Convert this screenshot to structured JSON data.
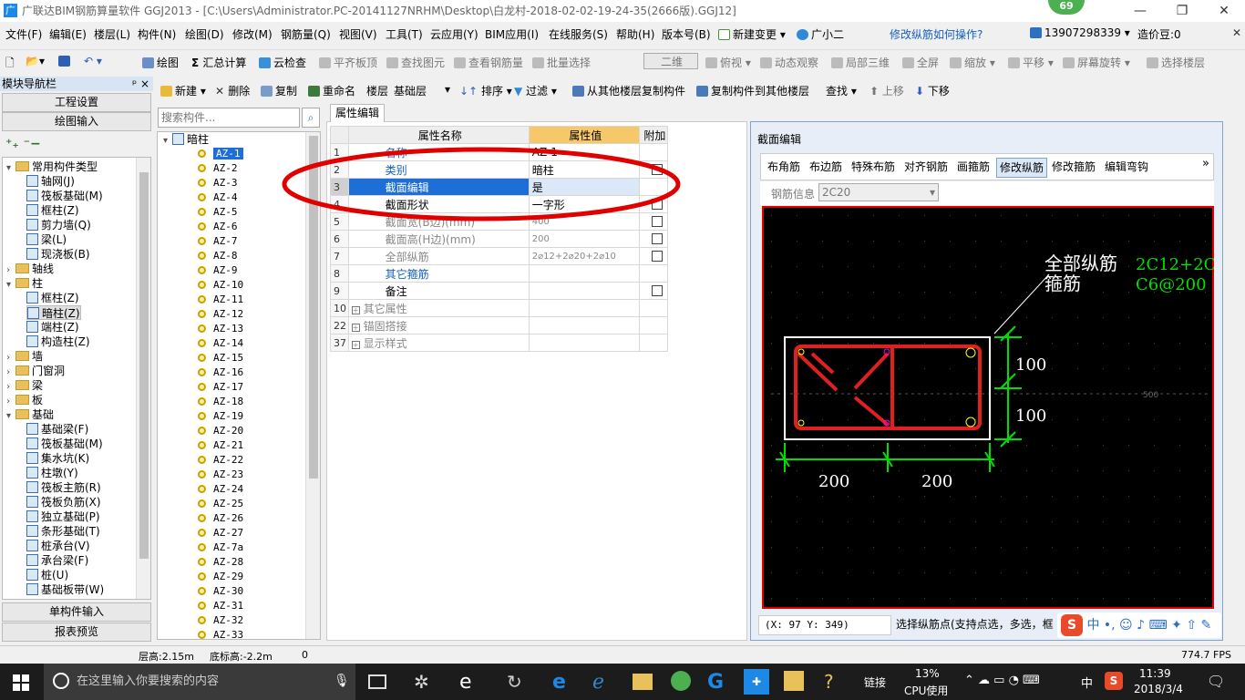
{
  "window": {
    "title": "广联达BIM钢筋算量软件 GGJ2013 - [C:\\Users\\Administrator.PC-20141127NRHM\\Desktop\\白龙村-2018-02-02-19-24-35(2666版).GGJ12]",
    "badge": "69",
    "minimize": "—",
    "restore": "❐",
    "close": "✕",
    "app_icon": "广"
  },
  "menu": [
    "文件(F)",
    "编辑(E)",
    "楼层(L)",
    "构件(N)",
    "绘图(D)",
    "修改(M)",
    "钢筋量(Q)",
    "视图(V)",
    "工具(T)",
    "云应用(Y)",
    "BIM应用(I)",
    "在线服务(S)",
    "帮助(H)",
    "版本号(B)",
    "新建变更 ▾",
    "广小二",
    "修改纵筋如何操作?",
    "13907298339 ▾",
    "造价豆:0"
  ],
  "toolbar1": [
    "绘图",
    "汇总计算",
    "云检查",
    "平齐板顶",
    "查找图元",
    "查看钢筋量",
    "批量选择",
    "二维",
    "俯视 ▾",
    "动态观察",
    "局部三维",
    "全屏",
    "缩放 ▾",
    "平移 ▾",
    "屏幕旋转 ▾",
    "选择楼层"
  ],
  "toolbar2": [
    "新建 ▾",
    "删除",
    "复制",
    "重命名",
    "楼层",
    "基础层",
    "排序 ▾",
    "过滤 ▾",
    "从其他楼层复制构件",
    "复制构件到其他楼层",
    "查找 ▾",
    "上移",
    "下移"
  ],
  "nav": {
    "header": "模块导航栏",
    "pin": "ᵖ ×",
    "btn_project": "工程设置",
    "btn_draw": "绘图输入",
    "btn_single": "单构件输入",
    "btn_report": "报表预览",
    "tree": [
      {
        "t": "常用构件类型",
        "lvl": 0,
        "folder": true,
        "exp": "▾"
      },
      {
        "t": "轴网(J)",
        "lvl": 1
      },
      {
        "t": "筏板基础(M)",
        "lvl": 1
      },
      {
        "t": "框柱(Z)",
        "lvl": 1
      },
      {
        "t": "剪力墙(Q)",
        "lvl": 1
      },
      {
        "t": "梁(L)",
        "lvl": 1
      },
      {
        "t": "现浇板(B)",
        "lvl": 1
      },
      {
        "t": "轴线",
        "lvl": 0,
        "folder": true,
        "exp": "›"
      },
      {
        "t": "柱",
        "lvl": 0,
        "folder": true,
        "exp": "▾"
      },
      {
        "t": "框柱(Z)",
        "lvl": 1
      },
      {
        "t": "暗柱(Z)",
        "lvl": 1,
        "sel": true
      },
      {
        "t": "端柱(Z)",
        "lvl": 1
      },
      {
        "t": "构造柱(Z)",
        "lvl": 1
      },
      {
        "t": "墙",
        "lvl": 0,
        "folder": true,
        "exp": "›"
      },
      {
        "t": "门窗洞",
        "lvl": 0,
        "folder": true,
        "exp": "›"
      },
      {
        "t": "梁",
        "lvl": 0,
        "folder": true,
        "exp": "›"
      },
      {
        "t": "板",
        "lvl": 0,
        "folder": true,
        "exp": "›"
      },
      {
        "t": "基础",
        "lvl": 0,
        "folder": true,
        "exp": "▾"
      },
      {
        "t": "基础梁(F)",
        "lvl": 1
      },
      {
        "t": "筏板基础(M)",
        "lvl": 1
      },
      {
        "t": "集水坑(K)",
        "lvl": 1
      },
      {
        "t": "柱墩(Y)",
        "lvl": 1
      },
      {
        "t": "筏板主筋(R)",
        "lvl": 1
      },
      {
        "t": "筏板负筋(X)",
        "lvl": 1
      },
      {
        "t": "独立基础(P)",
        "lvl": 1
      },
      {
        "t": "条形基础(T)",
        "lvl": 1
      },
      {
        "t": "桩承台(V)",
        "lvl": 1
      },
      {
        "t": "承台梁(F)",
        "lvl": 1
      },
      {
        "t": "桩(U)",
        "lvl": 1
      },
      {
        "t": "基础板带(W)",
        "lvl": 1
      }
    ]
  },
  "components": {
    "search_placeholder": "搜索构件...",
    "root": "暗柱",
    "items": [
      "AZ-1",
      "AZ-2",
      "AZ-3",
      "AZ-4",
      "AZ-5",
      "AZ-6",
      "AZ-7",
      "AZ-8",
      "AZ-9",
      "AZ-10",
      "AZ-11",
      "AZ-12",
      "AZ-13",
      "AZ-14",
      "AZ-15",
      "AZ-16",
      "AZ-17",
      "AZ-18",
      "AZ-19",
      "AZ-20",
      "AZ-21",
      "AZ-22",
      "AZ-23",
      "AZ-24",
      "AZ-25",
      "AZ-26",
      "AZ-27",
      "AZ-7a",
      "AZ-28",
      "AZ-29",
      "AZ-30",
      "AZ-31",
      "AZ-32",
      "AZ-33"
    ]
  },
  "props": {
    "tab": "属性编辑",
    "col_name": "属性名称",
    "col_value": "属性值",
    "col_add": "附加",
    "rows": [
      {
        "n": "1",
        "name": "名称",
        "val": "AZ-1",
        "style": "blue",
        "cb": false
      },
      {
        "n": "2",
        "name": "类别",
        "val": "暗柱",
        "style": "blue",
        "cb": true
      },
      {
        "n": "3",
        "name": "截面编辑",
        "val": "是",
        "style": "sel",
        "cb": false
      },
      {
        "n": "4",
        "name": "截面形状",
        "val": "一字形",
        "style": "",
        "cb": true
      },
      {
        "n": "5",
        "name": "截面宽(B边)(mm)",
        "val": "400",
        "style": "gray",
        "cb": true
      },
      {
        "n": "6",
        "name": "截面高(H边)(mm)",
        "val": "200",
        "style": "gray",
        "cb": true
      },
      {
        "n": "7",
        "name": "全部纵筋",
        "val": "2⌀12+2⌀20+2⌀10",
        "style": "gray",
        "cb": true
      },
      {
        "n": "8",
        "name": "其它箍筋",
        "val": "",
        "style": "blue",
        "cb": false
      },
      {
        "n": "9",
        "name": "备注",
        "val": "",
        "style": "",
        "cb": true
      },
      {
        "n": "10",
        "name": "其它属性",
        "val": "",
        "style": "gray",
        "plus": true,
        "cb": false
      },
      {
        "n": "22",
        "name": "锚固搭接",
        "val": "",
        "style": "gray",
        "plus": true,
        "cb": false
      },
      {
        "n": "37",
        "name": "显示样式",
        "val": "",
        "style": "gray",
        "plus": true,
        "cb": false
      }
    ]
  },
  "section": {
    "title": "截面编辑",
    "tabs": [
      "布角筋",
      "布边筋",
      "特殊布筋",
      "对齐钢筋",
      "画箍筋",
      "修改纵筋",
      "修改箍筋",
      "编辑弯钩"
    ],
    "active_tab": "修改纵筋",
    "rebar_label": "钢筋信息",
    "rebar_value": "2C20",
    "label1": "全部纵筋",
    "label2": "箍筋",
    "val1": "2C12+2C",
    "val2": "C6@200",
    "dim_v1": "100",
    "dim_v2": "100",
    "dim_h1": "200",
    "dim_h2": "200",
    "side": "500",
    "coord": "(X: 97 Y: 349)",
    "hint": "选择纵筋点(支持点选，多选，框"
  },
  "status": {
    "floor_h": "层高:2.15m",
    "bottom_h": "底标高:-2.2m",
    "zero": "0",
    "fps": "774.7 FPS"
  },
  "taskbar": {
    "search": "在这里输入你要搜索的内容",
    "link": "链接",
    "cpu": "13%",
    "cpu_label": "CPU使用",
    "time": "11:39",
    "date": "2018/3/4",
    "ime": "中",
    "s": "S"
  },
  "colors": {
    "accent": "#1e88e5",
    "annotation": "#e00000",
    "rebar": "#e02020",
    "dim": "#00dd00"
  }
}
